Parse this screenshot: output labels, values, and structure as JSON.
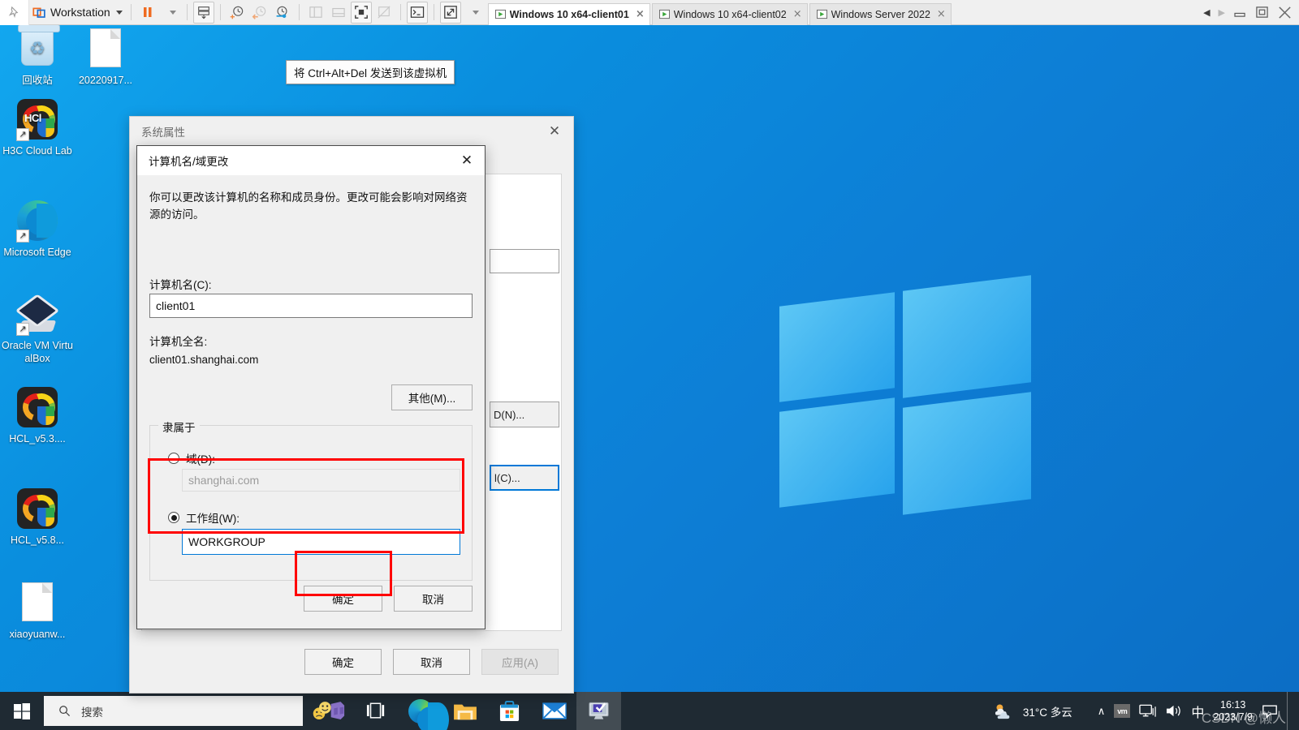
{
  "vmware": {
    "app_name": "Workstation",
    "pin_icon": "pin-icon",
    "menu_caret": "chevron-down-icon",
    "toolbar_icons": [
      "suspend-icon",
      "suspend-dropdown-icon",
      "snapshot-icon",
      "take-snapshot-icon",
      "revert-snapshot-icon",
      "snapshot-manager-icon",
      "show-sidebar-icon",
      "show-thumbnail-bar-icon",
      "full-screen-icon",
      "unity-mode-icon",
      "console-icon",
      "stretch-icon",
      "stretch-dropdown-icon"
    ],
    "tabs": [
      {
        "label": "Windows 10 x64-client01",
        "active": true,
        "close": "×",
        "icon": "vm-play-icon"
      },
      {
        "label": "Windows 10 x64-client02",
        "active": false,
        "close": "×",
        "icon": "vm-play-icon"
      },
      {
        "label": "Windows Server 2022",
        "active": false,
        "close": "×",
        "icon": "vm-play-icon"
      }
    ],
    "window_controls": {
      "prev": "◀",
      "next": "▶",
      "minimize": "minimize-icon",
      "restore": "restore-icon",
      "close": "close-icon"
    }
  },
  "tooltip": {
    "text": "将 Ctrl+Alt+Del 发送到该虚拟机"
  },
  "desktop": {
    "icons": [
      {
        "label": "回收站",
        "icon": "recycle-bin-icon"
      },
      {
        "label": "20220917...",
        "icon": "file-icon"
      },
      {
        "label": "H3C Cloud Lab",
        "icon": "h3c-cloud-lab-icon"
      },
      {
        "label": "Microsoft Edge",
        "icon": "microsoft-edge-icon"
      },
      {
        "label": "Oracle VM VirtualBox",
        "icon": "virtualbox-icon"
      },
      {
        "label": "HCL_v5.3....",
        "icon": "hcl-icon"
      },
      {
        "label": "HCL_v5.8...",
        "icon": "hcl-icon"
      },
      {
        "label": "xiaoyuanw...",
        "icon": "file-icon"
      }
    ]
  },
  "system_properties": {
    "title": "系统属性",
    "close": "✕",
    "hidden_buttons": [
      {
        "label": "D(N)...",
        "focused": false
      },
      {
        "label": "Ɩ(C)...",
        "focused": true
      }
    ],
    "footer_buttons": [
      {
        "label": "确定",
        "disabled": false
      },
      {
        "label": "取消",
        "disabled": false
      },
      {
        "label": "应用(A)",
        "disabled": true
      }
    ]
  },
  "computer_name_dialog": {
    "title": "计算机名/域更改",
    "close": "✕",
    "description": "你可以更改该计算机的名称和成员身份。更改可能会影响对网络资源的访问。",
    "computer_name_label": "计算机名(C):",
    "computer_name_value": "client01",
    "full_name_label": "计算机全名:",
    "full_name_value": "client01.shanghai.com",
    "more_button": "其他(M)...",
    "member_of_legend": "隶属于",
    "domain_radio_label": "域(D):",
    "domain_value": "shanghai.com",
    "domain_selected": false,
    "workgroup_radio_label": "工作组(W):",
    "workgroup_value": "WORKGROUP",
    "workgroup_selected": true,
    "ok_button": "确定",
    "cancel_button": "取消"
  },
  "taskbar": {
    "start_icon": "windows-start-icon",
    "search_icon": "search-icon",
    "search_placeholder": "搜索",
    "task_view_icon": "task-view-icon",
    "pinned": [
      {
        "icon": "vmware-tools-icon",
        "name": "vmware-tools"
      },
      {
        "icon": "task-view-icon",
        "name": "task-view"
      },
      {
        "icon": "microsoft-edge-icon",
        "name": "edge"
      },
      {
        "icon": "file-explorer-icon",
        "name": "file-explorer"
      },
      {
        "icon": "microsoft-store-icon",
        "name": "store"
      },
      {
        "icon": "mail-icon",
        "name": "mail"
      },
      {
        "icon": "system-properties-icon",
        "name": "system-properties",
        "active": true
      }
    ],
    "tray": {
      "weather_icon": "partly-cloudy-icon",
      "weather_text": "31°C 多云",
      "chevron_up": "∧",
      "vm_icon": "vmware-tray-icon",
      "network_icon": "network-icon",
      "volume_icon": "volume-icon",
      "ime_text": "中",
      "time": "16:13",
      "date": "2023/7/9",
      "notification_icon": "action-center-icon"
    }
  },
  "watermark": {
    "text": "CSDN @懒人"
  },
  "colors": {
    "accent": "#0078d7",
    "highlight_red": "#ff0000",
    "taskbar_bg": "#1f2a33",
    "desktop_blue": "#0a8ede"
  }
}
